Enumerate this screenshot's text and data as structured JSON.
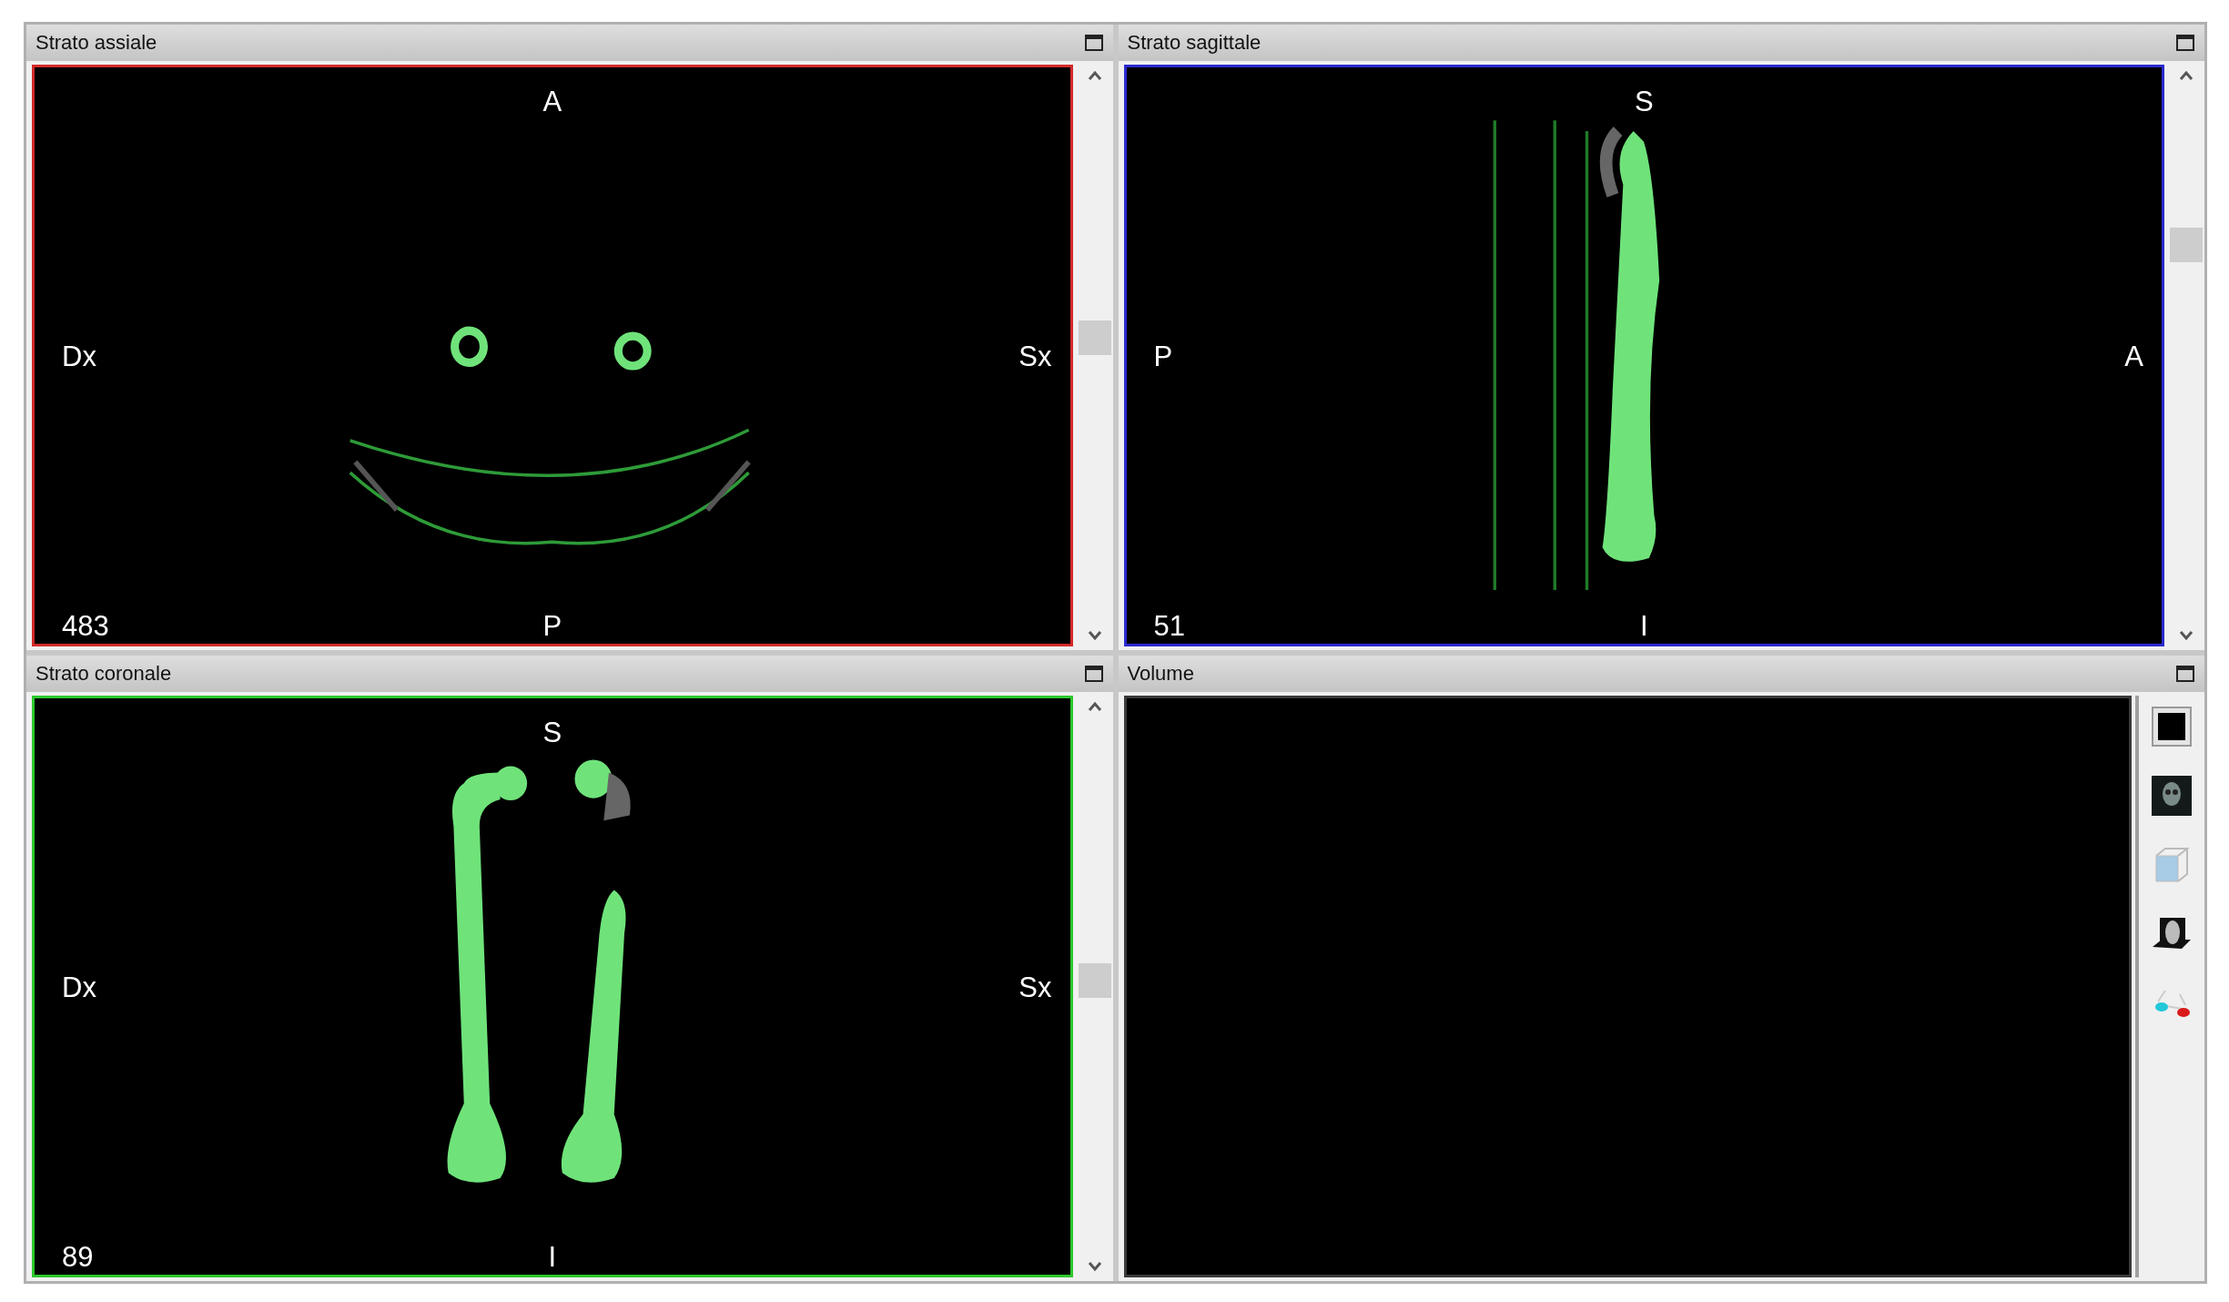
{
  "panels": [
    {
      "kind": "axial",
      "title": "Strato assiale",
      "color": "#d42a2a",
      "labels": {
        "top": "A",
        "left": "Dx",
        "right": "Sx",
        "bottom": "P"
      },
      "slice": "483"
    },
    {
      "kind": "sagittal",
      "title": "Strato sagittale",
      "color": "#2a2ad0",
      "labels": {
        "top": "S",
        "left": "P",
        "right": "A",
        "bottom": "I"
      },
      "slice": "51"
    },
    {
      "kind": "coronal",
      "title": "Strato coronale",
      "color": "#2ec82e",
      "labels": {
        "top": "S",
        "left": "Dx",
        "right": "Sx",
        "bottom": "I"
      },
      "slice": "89"
    },
    {
      "kind": "volume",
      "title": "Volume"
    }
  ]
}
